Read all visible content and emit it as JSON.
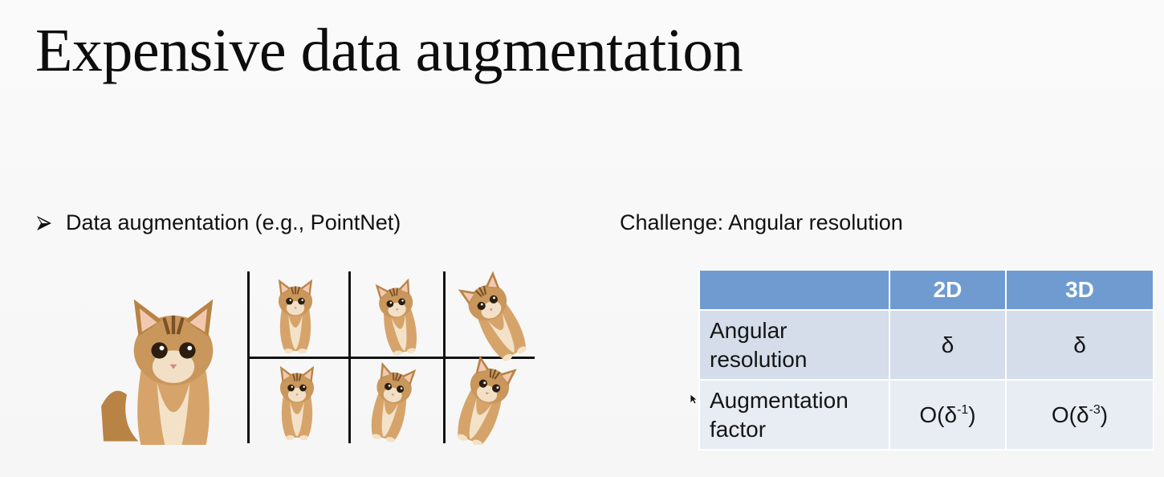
{
  "slide": {
    "title": "Expensive data augmentation",
    "bullet_text": "Data augmentation (e.g., PointNet)",
    "challenge_text": "Challenge: Angular resolution"
  },
  "table": {
    "headers": [
      "",
      "2D",
      "3D"
    ],
    "rows": [
      {
        "label_line1": "Angular",
        "label_line2": "resolution",
        "col_2d": "δ",
        "col_3d": "δ"
      },
      {
        "label_line1": "Augmentation",
        "label_line2": "factor",
        "col_2d_base": "O(δ",
        "col_2d_exp": "-1",
        "col_2d_close": ")",
        "col_3d_base": "O(δ",
        "col_3d_exp": "-3",
        "col_3d_close": ")"
      }
    ]
  },
  "colors": {
    "header_blue": "#6f9bd1",
    "row_dark": "#d4dde9",
    "row_light": "#e8edf4",
    "cat_fur": "#c9975c"
  },
  "icons": {
    "bullet": "arrowhead-bullet-icon",
    "cursor": "mouse-pointer-icon"
  }
}
